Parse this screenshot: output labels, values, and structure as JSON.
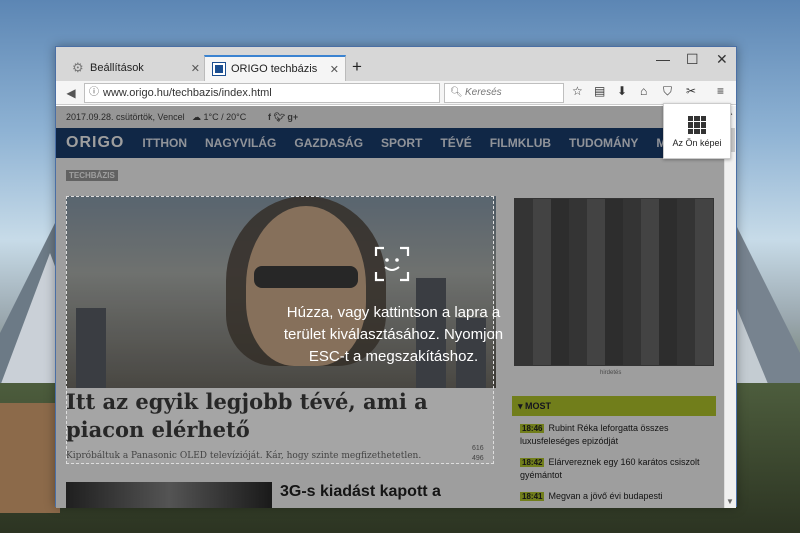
{
  "tabs": [
    {
      "label": "Beállítások"
    },
    {
      "label": "ORIGO techbázis"
    }
  ],
  "url": "www.origo.hu/techbazis/index.html",
  "search_placeholder": "Keresés",
  "page": {
    "date": "2017.09.28. csütörtök, Vencel",
    "weather": "1°C / 20°C",
    "logo": "ORIGO",
    "nav": [
      "ITTHON",
      "NAGYVILÁG",
      "GAZDASÁG",
      "SPORT",
      "TÉVÉ",
      "FILMKLUB",
      "TUDOMÁNY",
      "MÉ"
    ],
    "tag": "TECHBÁZIS",
    "headline": "Itt az egyik legjobb tévé, ami a piacon elérhető",
    "lead": "Kipróbáltuk a Panasonic OLED televízióját. Kár, hogy szinte megfizethetetlen.",
    "counter": [
      "616",
      "496"
    ],
    "second_headline": "3G-s kiadást kapott a",
    "ad_label": "hirdetés",
    "most_label": "MOST",
    "news": [
      {
        "time": "18:46",
        "text": "Rubint Réka leforgatta összes luxusfeleséges epizódját"
      },
      {
        "time": "18:42",
        "text": "Elárvereznek egy 160 karátos csiszolt gyémántot"
      },
      {
        "time": "18:41",
        "text": "Megvan a jövő évi budapesti"
      }
    ]
  },
  "overlay": {
    "instructions": "Húzza, vagy kattintson a lapra a terület kiválasztásához. Nyomjon ESC-t a megszakításhoz."
  },
  "panel": {
    "label": "Az Ön képei"
  }
}
